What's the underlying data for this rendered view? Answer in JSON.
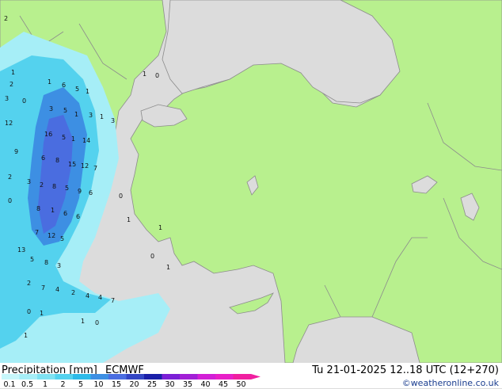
{
  "legend": {
    "title": "Precipitation [mm]",
    "model": "ECMWF",
    "ticks": [
      "0.1",
      "0.5",
      "1",
      "2",
      "5",
      "10",
      "15",
      "20",
      "25",
      "30",
      "35",
      "40",
      "45",
      "50"
    ],
    "colors": [
      "#c7f7fb",
      "#a6eef7",
      "#7fe2f2",
      "#54d2ee",
      "#2dbbe9",
      "#3d8fe3",
      "#4a6de0",
      "#3346c4",
      "#1a1fa8",
      "#7b1fd6",
      "#a21fd6",
      "#d21fd6",
      "#e81fc8",
      "#f01fa0"
    ]
  },
  "valid": "Tu 21-01-2025 12..18 UTC (12+270)",
  "credit": "©weatheronline.co.uk",
  "map": {
    "land_color": "#b8f08e",
    "sea_color": "#dcdcdc",
    "border_color": "#8c8c8c",
    "rain_labels": [
      "2",
      "1",
      "2",
      "3",
      "0",
      "12",
      "9",
      "2",
      "0",
      "1",
      "6",
      "5",
      "1",
      "3",
      "5",
      "1",
      "3",
      "1",
      "3",
      "16",
      "5",
      "1",
      "14",
      "6",
      "8",
      "15",
      "12",
      "7",
      "3",
      "2",
      "8",
      "5",
      "9",
      "6",
      "8",
      "1",
      "6",
      "6",
      "7",
      "12",
      "5",
      "13",
      "5",
      "8",
      "3",
      "2",
      "7",
      "4",
      "2",
      "4",
      "4",
      "7",
      "0",
      "1",
      "1",
      "0",
      "1",
      "0",
      "1",
      "1",
      "0",
      "1",
      "1",
      "0"
    ]
  }
}
